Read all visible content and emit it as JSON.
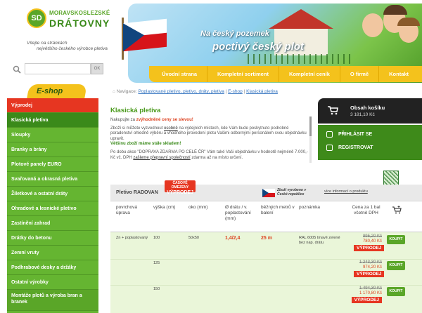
{
  "logo": {
    "mark": "SD",
    "line1": "MORAVSKOSLEZSKÉ",
    "line2": "DRÁTOVNY"
  },
  "welcome": {
    "line1": "Vítejte na stránkách",
    "line2": "největšího českého výrobce pletiva"
  },
  "search": {
    "placeholder": "",
    "button": "OK"
  },
  "banner": {
    "slogan1": "Na český pozemek",
    "slogan2": "poctivý český plot"
  },
  "nav": [
    "Úvodní strana",
    "Kompletní sortiment",
    "Kompletní ceník",
    "O firmě",
    "Kontakt"
  ],
  "sidebar": {
    "tab": "E-shop",
    "items": [
      "Výprodej",
      "Klasická pletiva",
      "Sloupky",
      "Branky a brány",
      "Plotové panely EURO",
      "Svařovaná a okrasná pletiva",
      "Žiletkové a ostatní dráty",
      "Ohradové a lesnické pletivo",
      "Zastínění zahrad",
      "Drátky do betonu",
      "Zemní vruty",
      "Podhrabové desky a držáky",
      "Ostatní výrobky",
      "Montáže plotů a výroba bran a branek"
    ]
  },
  "breadcrumb": {
    "prefix": "Navigace:",
    "l1": "Poplastované pletivo, pletivo, dráty, pletiva",
    "sep1": "|",
    "l2": "E-shop",
    "sep2": "|",
    "l3": "Klasická pletiva"
  },
  "content": {
    "title": "Klasická pletiva",
    "p1_a": "Nakupujte za ",
    "p1_b": "zvýhodněné ceny se slevou!",
    "p2_a": "Zboží si můžete vyzvednout ",
    "p2_b": "osobně",
    "p2_c": " na výdejních místech, kde Vám bude poskytnuto podrobné poradenství ohledně výběru a vhodného provedení plotu Vašimi odbornými personálem svou objednávku upravit.",
    "p3": "Většinu zboží máme stále skladem!",
    "p4_a": "Po dobu akce \"DOPRAVA ZDARMA PO CELÉ ČR\" Vám také Vaši objednávku v hodnotě nejméně 7.000,- Kč vč. DPH ",
    "p4_b": "zašleme přepravní společností",
    "p4_c": " zdarma až na místo určení."
  },
  "cart": {
    "title": "Obsah košíku",
    "price": "3 181,10 Kč"
  },
  "login": {
    "signin": "PŘIHLÁSIT SE",
    "register": "REGISTROVAT"
  },
  "product": {
    "name": "Pletivo RADOVAN",
    "badge_top": "ČASOVĚ OMEZENÝ",
    "badge_main": "VÝPRODEJ",
    "cz_text": "Zboží vyrobeno v České republice",
    "more": "více informací o produktu",
    "headers": {
      "c1": "povrchová úprava",
      "c2": "výška (cm)",
      "c3": "oko (mm)",
      "c4": "Ø drátu / v. poplastování (mm)",
      "c5": "běžných metrů v balení",
      "c6": "poznámka",
      "c7": "Cena za 1 bal včetně DPH"
    },
    "rows": [
      {
        "c1": "Zn + poplastovaný",
        "c2": "100",
        "c3": "50x50",
        "c4": "1,4/2,4",
        "c5": "25 m",
        "c6": "RAL 6005 tmavě zelené bez nap. drátu",
        "old": "895,20 Kč",
        "new": "780,40 Kč",
        "sale": "VÝPRODEJ",
        "buy": "KOUPIT"
      },
      {
        "c1": "",
        "c2": "125",
        "c3": "",
        "c4": "",
        "c5": "",
        "c6": "",
        "old": "1 243,30 Kč",
        "new": "974,20 Kč",
        "sale": "VÝPRODEJ",
        "buy": "KOUPIT"
      },
      {
        "c1": "",
        "c2": "150",
        "c3": "",
        "c4": "",
        "c5": "",
        "c6": "",
        "old": "1 494,30 Kč",
        "new": "1 170,80 Kč",
        "sale": "VÝPRODEJ",
        "buy": "KOUPIT"
      }
    ]
  },
  "colors": {
    "green": "#65b531",
    "dark_green": "#3e8a1a",
    "yellow": "#f4c21c",
    "red": "#e63621"
  }
}
